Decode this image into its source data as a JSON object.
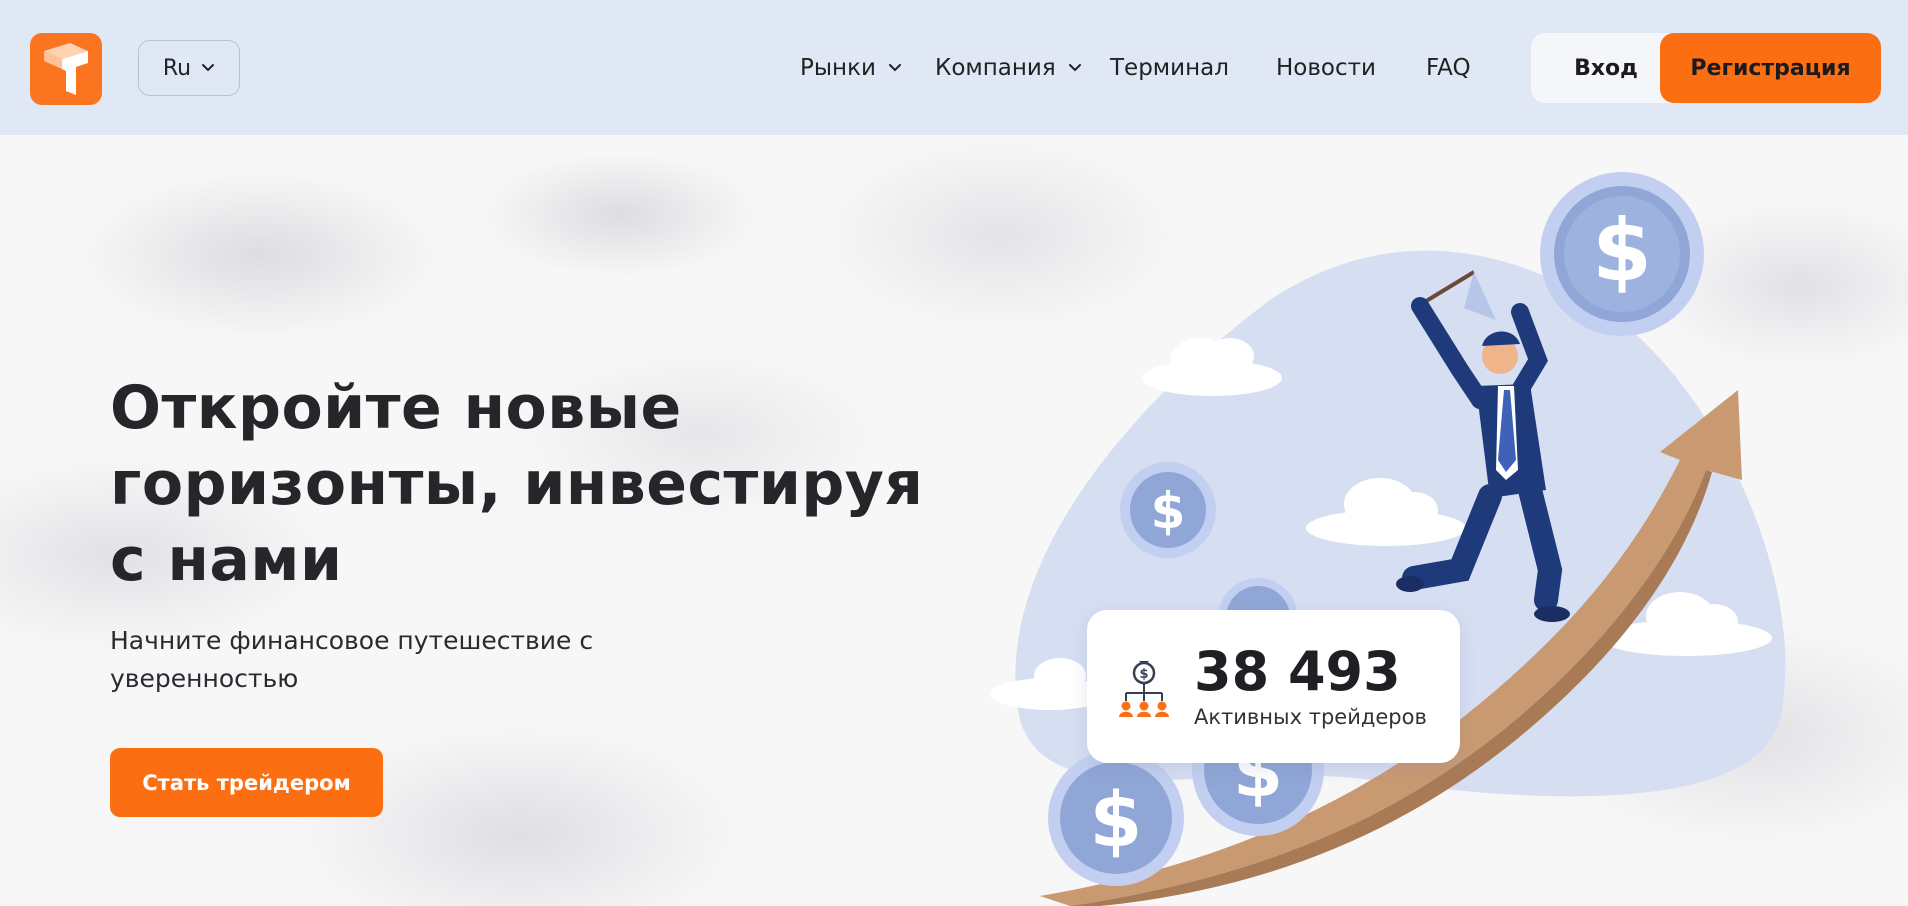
{
  "header": {
    "language": "Ru",
    "nav": [
      {
        "label": "Рынки",
        "dropdown": true
      },
      {
        "label": "Компания",
        "dropdown": true
      },
      {
        "label": "Терминал",
        "dropdown": false
      },
      {
        "label": "Новости",
        "dropdown": false
      },
      {
        "label": "FAQ",
        "dropdown": false
      }
    ],
    "login_label": "Вход",
    "register_label": "Регистрация"
  },
  "hero": {
    "title_line1": "Откройте новые",
    "title_line2": "горизонты, инвестируя",
    "title_line3": "с нами",
    "subtitle_line1": "Начните финансовое путешествие с",
    "subtitle_line2": "уверенностью",
    "cta_label": "Стать трейдером"
  },
  "stats": {
    "value": "38 493",
    "label": "Активных трейдеров"
  },
  "colors": {
    "accent": "#fb6f12",
    "header_bg": "#e1e8f5",
    "coin": "#8fa6d6",
    "arrow": "#c99a72",
    "suit": "#1f3a7a"
  },
  "icons": {
    "logo": "brand-logo-icon",
    "language_chevron": "chevron-down-icon",
    "stats": "money-bag-network-icon"
  }
}
